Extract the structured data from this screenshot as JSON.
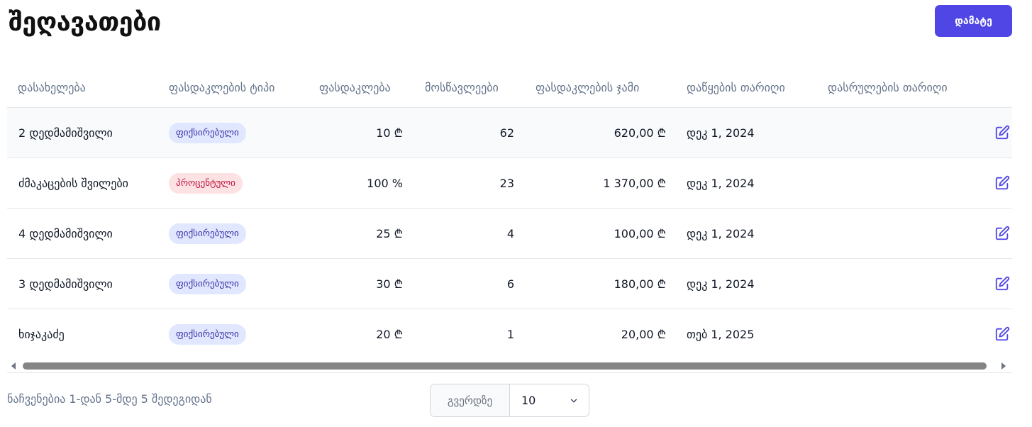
{
  "page": {
    "title": "შეღავათები",
    "add_button_label": "დამატე"
  },
  "table": {
    "columns": [
      "დასახელება",
      "ფასდაკლების ტიპი",
      "ფასდაკლება",
      "მოსწავლეები",
      "ფასდაკლების ჯამი",
      "დაწყების თარიღი",
      "დასრულების თარიღი"
    ],
    "rows": [
      {
        "name": "2 დედმამიშვილი",
        "type": "ფიქსირებული",
        "type_kind": "fixed",
        "discount": "10 ₾",
        "students": "62",
        "total": "620,00 ₾",
        "start_date": "დეკ 1, 2024",
        "end_date": ""
      },
      {
        "name": "ძმაკაცების შვილები",
        "type": "პროცენტული",
        "type_kind": "percent",
        "discount": "100 %",
        "students": "23",
        "total": "1 370,00 ₾",
        "start_date": "დეკ 1, 2024",
        "end_date": ""
      },
      {
        "name": "4 დედმამიშვილი",
        "type": "ფიქსირებული",
        "type_kind": "fixed",
        "discount": "25 ₾",
        "students": "4",
        "total": "100,00 ₾",
        "start_date": "დეკ 1, 2024",
        "end_date": ""
      },
      {
        "name": "3 დედმამიშვილი",
        "type": "ფიქსირებული",
        "type_kind": "fixed",
        "discount": "30 ₾",
        "students": "6",
        "total": "180,00 ₾",
        "start_date": "დეკ 1, 2024",
        "end_date": ""
      },
      {
        "name": "ხიჯაკაძე",
        "type": "ფიქსირებული",
        "type_kind": "fixed",
        "discount": "20 ₾",
        "students": "1",
        "total": "20,00 ₾",
        "start_date": "თებ 1, 2025",
        "end_date": ""
      }
    ],
    "row_action_icon": "edit-icon"
  },
  "footer": {
    "summary": "ნაჩვენებია 1-დან 5-მდე 5 შედეგიდან",
    "per_page_label": "გვერდზე",
    "per_page_value": "10"
  },
  "colors": {
    "accent": "#4f46e5",
    "fixed_badge_bg": "#e0e7ff",
    "fixed_badge_text": "#3730a3",
    "percent_badge_bg": "#fde2e4",
    "percent_badge_text": "#be123c"
  }
}
